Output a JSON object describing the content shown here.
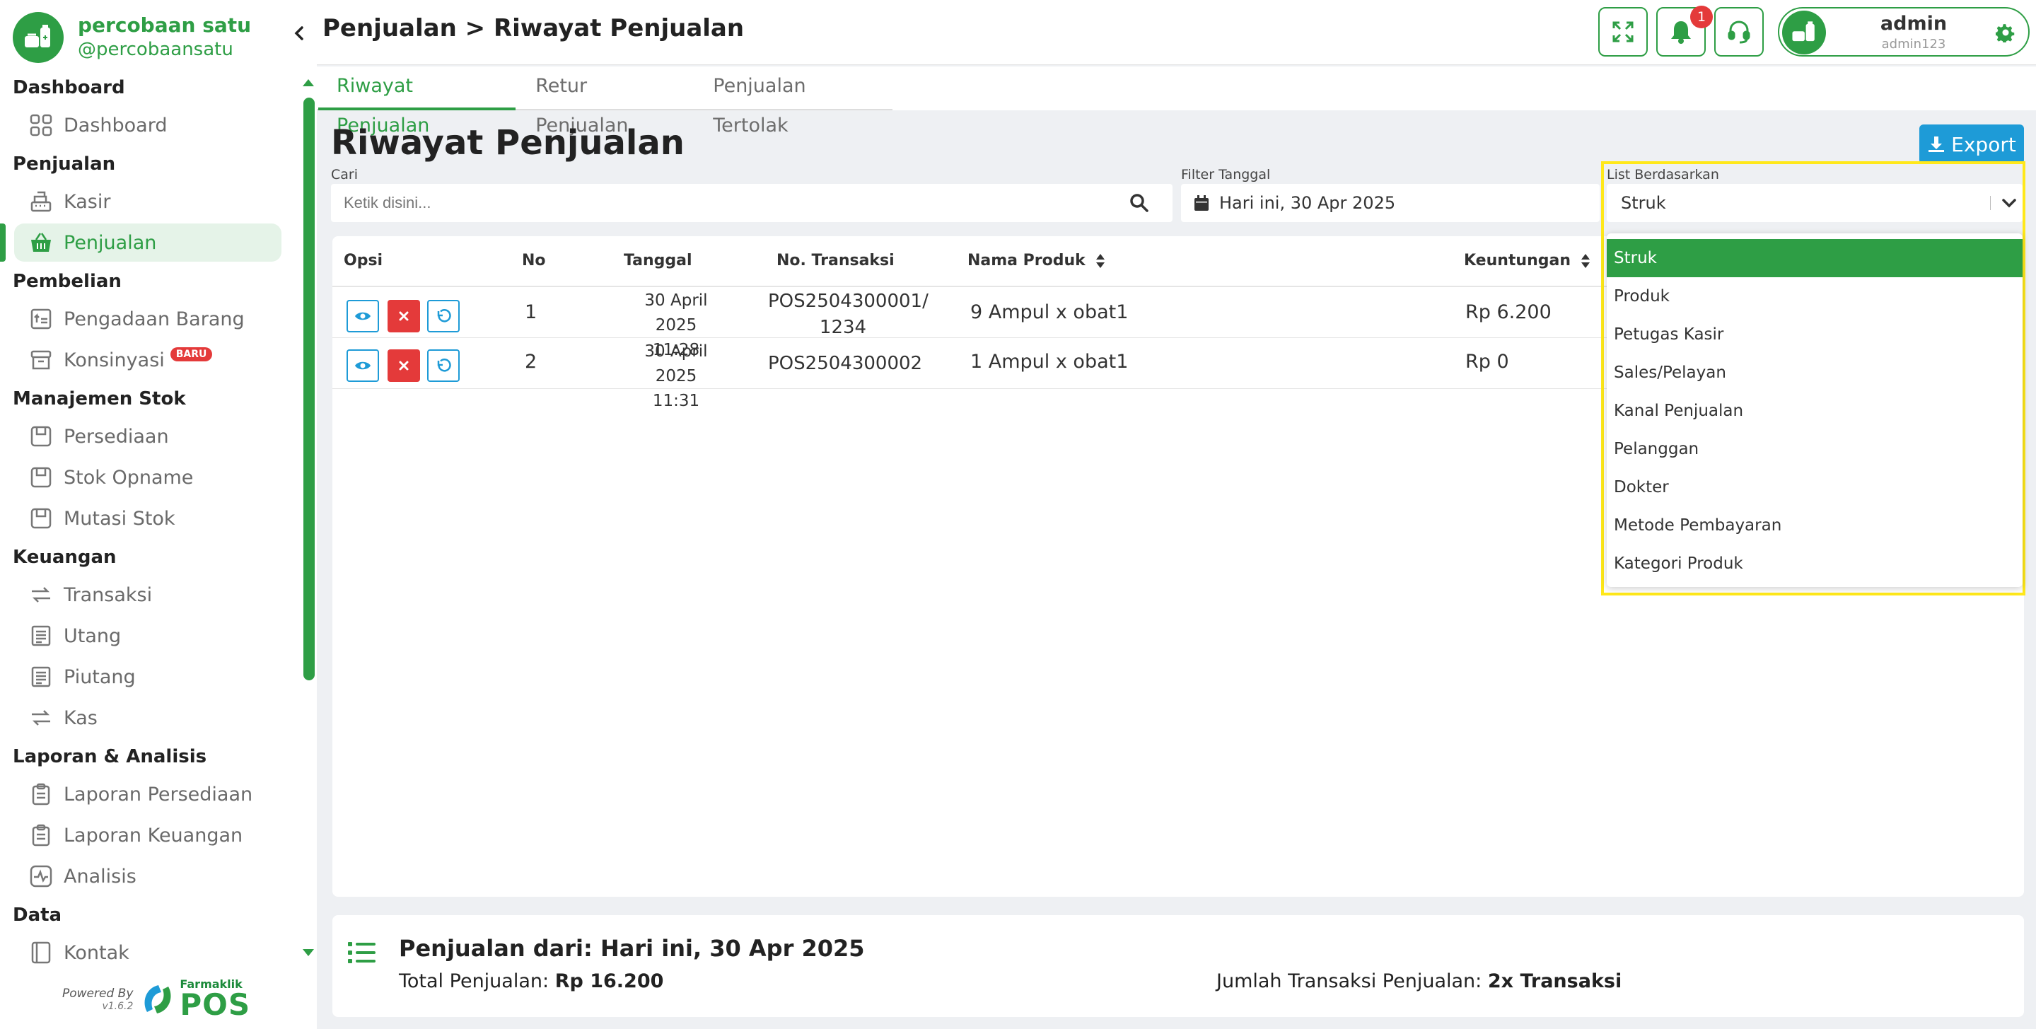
{
  "brand": {
    "name": "percobaan satu",
    "handle": "@percobaansatu"
  },
  "sidebar": {
    "sections": [
      {
        "title": "Dashboard",
        "items": [
          {
            "label": "Dashboard",
            "icon": "grid-icon"
          }
        ]
      },
      {
        "title": "Penjualan",
        "items": [
          {
            "label": "Kasir",
            "icon": "cash-register-icon"
          },
          {
            "label": "Penjualan",
            "icon": "basket-icon",
            "active": true
          }
        ]
      },
      {
        "title": "Pembelian",
        "items": [
          {
            "label": "Pengadaan Barang",
            "icon": "procurement-icon"
          },
          {
            "label": "Konsinyasi",
            "icon": "archive-icon",
            "badge": "BARU"
          }
        ]
      },
      {
        "title": "Manajemen Stok",
        "items": [
          {
            "label": "Persediaan",
            "icon": "inventory-icon"
          },
          {
            "label": "Stok Opname",
            "icon": "inventory-icon"
          },
          {
            "label": "Mutasi Stok",
            "icon": "inventory-icon"
          }
        ]
      },
      {
        "title": "Keuangan",
        "items": [
          {
            "label": "Transaksi",
            "icon": "exchange-icon"
          },
          {
            "label": "Utang",
            "icon": "receipt-icon"
          },
          {
            "label": "Piutang",
            "icon": "receipt-icon"
          },
          {
            "label": "Kas",
            "icon": "exchange-icon"
          }
        ]
      },
      {
        "title": "Laporan & Analisis",
        "items": [
          {
            "label": "Laporan Persediaan",
            "icon": "clipboard-icon"
          },
          {
            "label": "Laporan Keuangan",
            "icon": "clipboard-icon"
          },
          {
            "label": "Analisis",
            "icon": "activity-icon"
          }
        ]
      },
      {
        "title": "Data",
        "items": [
          {
            "label": "Kontak",
            "icon": "contact-book-icon"
          }
        ]
      }
    ],
    "powered": {
      "label": "Powered By",
      "version": "v1.6.2",
      "logo_top": "Farmaklik",
      "logo_big": "POS"
    }
  },
  "header": {
    "breadcrumb": "Penjualan > Riwayat Penjualan",
    "notification_count": "1",
    "user": {
      "name": "admin",
      "id": "admin123"
    }
  },
  "tabs": [
    {
      "label": "Riwayat Penjualan",
      "active": true
    },
    {
      "label": "Retur Penjualan",
      "active": false
    },
    {
      "label": "Penjualan Tertolak",
      "active": false
    }
  ],
  "page": {
    "title": "Riwayat Penjualan",
    "export_label": "Export",
    "search": {
      "label": "Cari",
      "placeholder": "Ketik disini..."
    },
    "date_filter": {
      "label": "Filter Tanggal",
      "value": "Hari ini, 30 Apr 2025"
    },
    "list_by": {
      "label": "List Berdasarkan",
      "value": "Struk",
      "options": [
        "Struk",
        "Produk",
        "Petugas Kasir",
        "Sales/Pelayan",
        "Kanal Penjualan",
        "Pelanggan",
        "Dokter",
        "Metode Pembayaran",
        "Kategori Produk"
      ]
    }
  },
  "table": {
    "headers": {
      "opsi": "Opsi",
      "no": "No",
      "tanggal": "Tanggal",
      "transaksi": "No. Transaksi",
      "produk": "Nama Produk",
      "keuntungan": "Keuntungan"
    },
    "rows": [
      {
        "no": "1",
        "date": "30 April 2025",
        "time": "11:28",
        "trx1": "POS2504300001/",
        "trx2": "1234",
        "product": "9 Ampul x obat1",
        "profit": "Rp 6.200"
      },
      {
        "no": "2",
        "date": "30 April 2025",
        "time": "11:31",
        "trx1": "POS2504300002",
        "trx2": "",
        "product": "1 Ampul x obat1",
        "profit": "Rp 0"
      }
    ]
  },
  "summary": {
    "title": "Penjualan dari: Hari ini, 30 Apr 2025",
    "total_label": "Total Penjualan: ",
    "total_value": "Rp 16.200",
    "count_label": "Jumlah Transaksi Penjualan: ",
    "count_value": "2x Transaksi"
  },
  "colors": {
    "brand_green": "#2e9e45",
    "accent_blue": "#1e9bd7",
    "danger_red": "#e43a3a",
    "highlight_yellow": "#ffe81a"
  }
}
